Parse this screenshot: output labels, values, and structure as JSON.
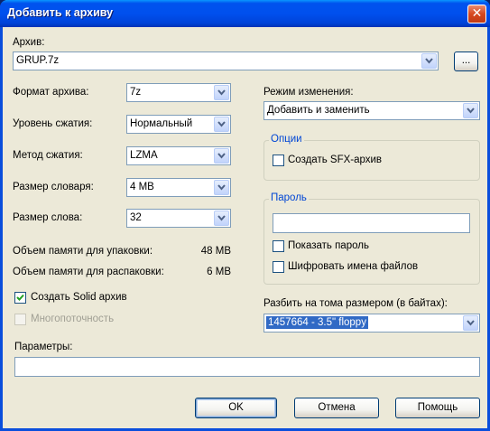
{
  "window": {
    "title": "Добавить к архиву",
    "close_glyph": "✕"
  },
  "archive": {
    "label": "Архив:",
    "value": "GRUP.7z",
    "browse_label": "..."
  },
  "format": {
    "label": "Формат архива:",
    "value": "7z"
  },
  "level": {
    "label": "Уровень сжатия:",
    "value": "Нормальный"
  },
  "method": {
    "label": "Метод сжатия:",
    "value": "LZMA"
  },
  "dict": {
    "label": "Размер словаря:",
    "value": "4 MB"
  },
  "word": {
    "label": "Размер слова:",
    "value": "32"
  },
  "memory": {
    "pack_label": "Объем памяти для упаковки:",
    "pack_value": "48 MB",
    "unpack_label": "Объем памяти для распаковки:",
    "unpack_value": "6 MB"
  },
  "solid": {
    "label": "Создать Solid архив",
    "checked": true
  },
  "multithread": {
    "label": "Многопоточность",
    "checked": false,
    "enabled": false
  },
  "params": {
    "label": "Параметры:",
    "value": ""
  },
  "update_mode": {
    "label": "Режим изменения:",
    "value": "Добавить и заменить"
  },
  "options": {
    "title": "Опции",
    "sfx_label": "Создать SFX-архив",
    "sfx_checked": false
  },
  "password": {
    "title": "Пароль",
    "value": "",
    "show_label": "Показать пароль",
    "show_checked": false,
    "encrypt_names_label": "Шифровать имена файлов",
    "encrypt_names_checked": false
  },
  "volume": {
    "label": "Разбить на тома размером (в байтах):",
    "value": "1457664 - 3.5\" floppy"
  },
  "buttons": {
    "ok": "OK",
    "cancel": "Отмена",
    "help": "Помощь"
  },
  "colors": {
    "title_bar": "#0054E3",
    "dialog_bg": "#ECE9D8",
    "group_title": "#0046D5",
    "selection": "#316AC5"
  }
}
